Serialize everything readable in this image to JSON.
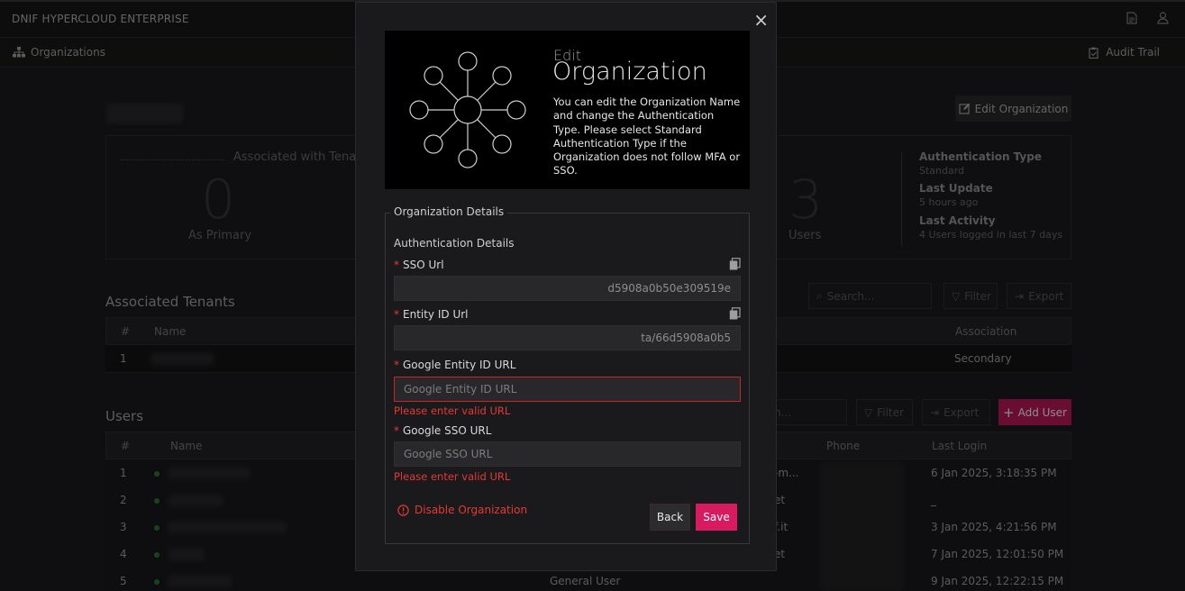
{
  "header": {
    "brand": "DNIF HYPERCLOUD ENTERPRISE",
    "icons": [
      "document-icon",
      "user-icon"
    ]
  },
  "subbar": {
    "crumb": "Organizations",
    "audit": "Audit Trail"
  },
  "page": {
    "edit_org_label": "Edit Organization",
    "stats": {
      "assoc_label": "Associated with Tenan",
      "primary_value": "0",
      "primary_label": "As Primary",
      "users_value": "3",
      "users_label": "Users",
      "auth_type_label": "Authentication Type",
      "auth_type_value": "Standard",
      "last_update_label": "Last Update",
      "last_update_value": "5 hours ago",
      "last_activity_label": "Last Activity",
      "last_activity_value": "4 Users logged in last 7 days"
    },
    "tenants": {
      "title": "Associated Tenants",
      "search_placeholder": "Search...",
      "filter": "Filter",
      "export": "Export",
      "columns": [
        "#",
        "Name",
        "Association"
      ],
      "rows": [
        {
          "num": "1",
          "association": "Secondary"
        }
      ]
    },
    "users": {
      "title": "Users",
      "search_placeholder": "h...",
      "filter": "Filter",
      "export": "Export",
      "add_user": "Add User",
      "columns": [
        "#",
        "Name",
        "Phone",
        "Last Login"
      ],
      "rows": [
        {
          "num": "1",
          "email_tail": "-m...",
          "last_login": "6 Jan 2025, 3:18:35 PM"
        },
        {
          "num": "2",
          "email_tail": "et",
          "last_login": "_"
        },
        {
          "num": "3",
          "email_tail": "f.it",
          "last_login": "3 Jan 2025, 4:21:56 PM"
        },
        {
          "num": "4",
          "email_tail": "et",
          "last_login": "7 Jan 2025, 12:01:50 PM"
        },
        {
          "num": "5",
          "role": "General User",
          "last_login": "9 Jan 2025, 12:22:15 PM"
        }
      ]
    }
  },
  "modal": {
    "close": "×",
    "hero_small": "Edit",
    "hero_big": "Organization",
    "hero_desc": "You can edit the Organization Name and change the Authentication Type. Please select Standard Authentication Type if the Organization does not follow MFA or SSO.",
    "legend": "Organization Details",
    "subhead": "Authentication Details",
    "fields": {
      "sso_url": {
        "label": "SSO Url",
        "value": "d5908a0b50e309519e"
      },
      "entity_id_url": {
        "label": "Entity ID Url",
        "value": "ta/66d5908a0b5"
      },
      "google_entity": {
        "label": "Google Entity ID URL",
        "placeholder": "Google Entity ID URL",
        "error": "Please enter valid URL"
      },
      "google_sso": {
        "label": "Google SSO URL",
        "placeholder": "Google SSO URL",
        "error": "Please enter valid URL"
      }
    },
    "disable": "Disable Organization",
    "back": "Back",
    "save": "Save"
  },
  "colors": {
    "accent": "#d81b60",
    "error": "#e53935",
    "bg": "#1c1c1f"
  }
}
